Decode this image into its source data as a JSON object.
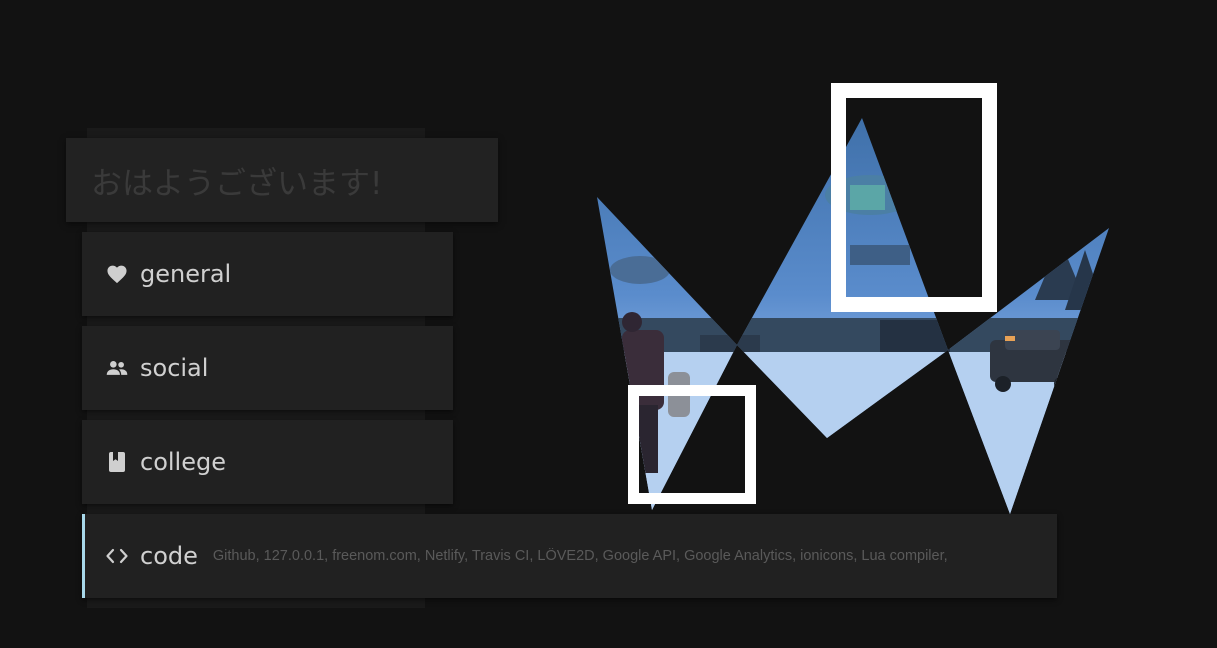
{
  "greeting": {
    "text": "おはようございます!"
  },
  "menu": {
    "items": [
      {
        "label": "general",
        "icon": "heart-icon"
      },
      {
        "label": "social",
        "icon": "people-icon"
      },
      {
        "label": "college",
        "icon": "book-icon"
      },
      {
        "label": "code",
        "icon": "code-brackets-icon"
      }
    ],
    "code_links": "Github, 127.0.0.1, freenom.com, Netlify, Travis CI, LÖVE2D, Google API, Google Analytics, ionicons, Lua compiler,"
  },
  "colors": {
    "background": "#121212",
    "card": "#212121",
    "accent": "#a8d8ea",
    "text": "#d0d0d0",
    "muted": "#5a5a5a"
  }
}
